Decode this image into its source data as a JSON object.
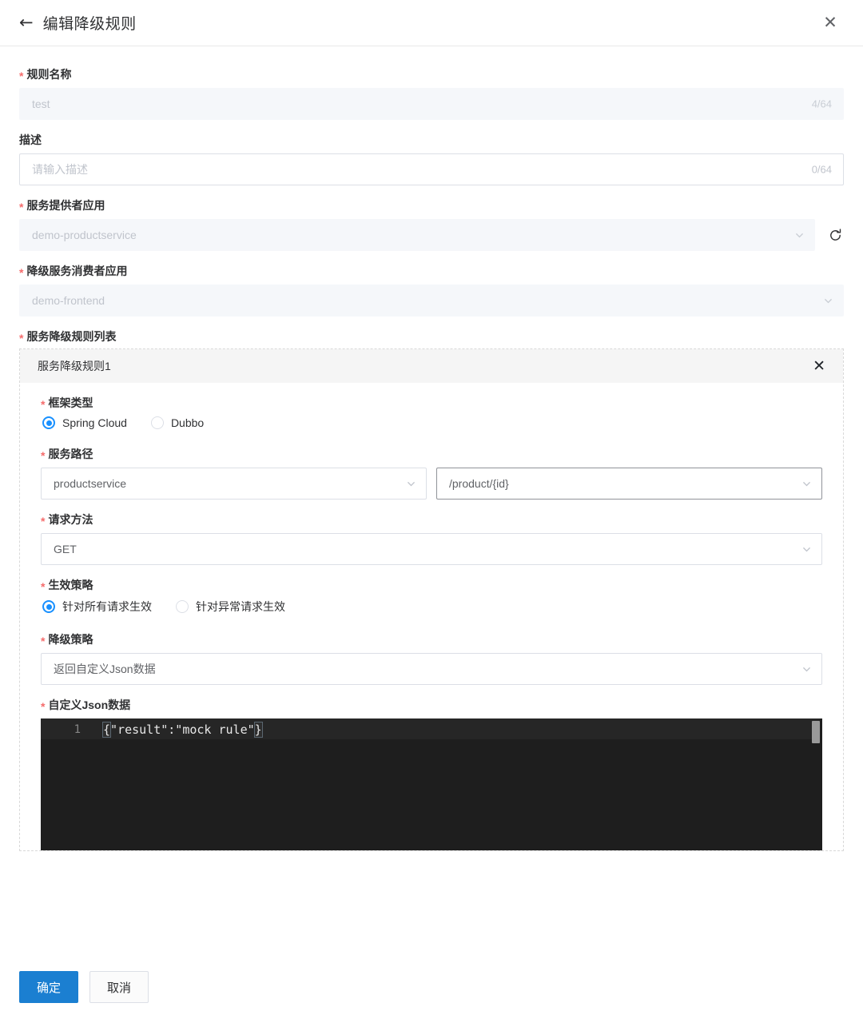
{
  "header": {
    "back_icon": "arrow-left-icon",
    "title": "编辑降级规则",
    "close_icon": "close-icon"
  },
  "form": {
    "rule_name": {
      "label": "规则名称",
      "required_marker": "*",
      "value": "test",
      "counter": "4/64",
      "disabled": true
    },
    "description": {
      "label": "描述",
      "placeholder": "请输入描述",
      "counter": "0/64",
      "disabled": false
    },
    "provider_app": {
      "label": "服务提供者应用",
      "required_marker": "*",
      "value": "demo-productservice",
      "disabled": true,
      "refresh_icon": "refresh-icon"
    },
    "consumer_app": {
      "label": "降级服务消费者应用",
      "required_marker": "*",
      "value": "demo-frontend",
      "disabled": true
    },
    "rule_list": {
      "label": "服务降级规则列表",
      "required_marker": "*"
    }
  },
  "rule_card": {
    "title": "服务降级规则1",
    "close_icon": "close-icon",
    "framework_type": {
      "label": "框架类型",
      "required_marker": "*",
      "options": [
        "Spring Cloud",
        "Dubbo"
      ],
      "selected": "Spring Cloud"
    },
    "service_path": {
      "label": "服务路径",
      "required_marker": "*",
      "service_value": "productservice",
      "path_value": "/product/{id}"
    },
    "request_method": {
      "label": "请求方法",
      "required_marker": "*",
      "value": "GET"
    },
    "effect_policy": {
      "label": "生效策略",
      "required_marker": "*",
      "options": [
        "针对所有请求生效",
        "针对异常请求生效"
      ],
      "selected": "针对所有请求生效"
    },
    "degrade_policy": {
      "label": "降级策略",
      "required_marker": "*",
      "value": "返回自定义Json数据"
    },
    "custom_json": {
      "label": "自定义Json数据",
      "required_marker": "*",
      "line_number": "1",
      "open_brace": "{",
      "content": "\"result\":\"mock rule\"",
      "close_brace": "}"
    }
  },
  "footer": {
    "confirm_label": "确定",
    "cancel_label": "取消"
  },
  "colors": {
    "accent": "#1890ff",
    "primary_button": "#1b7fd1",
    "required": "#f56c6c",
    "editor_bg": "#1e1e1e"
  }
}
